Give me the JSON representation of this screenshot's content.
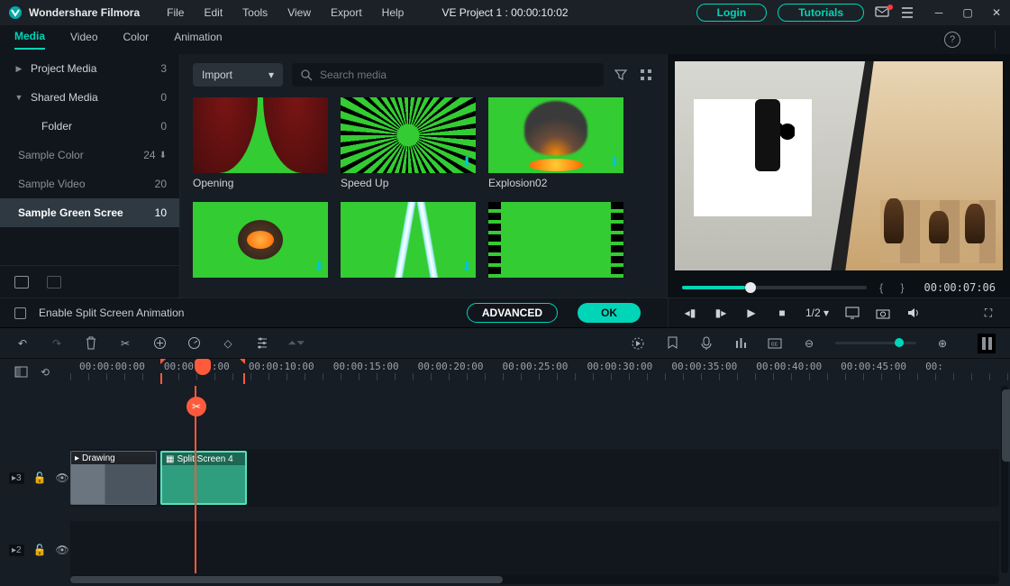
{
  "app": {
    "name": "Wondershare Filmora",
    "project_title": "VE Project 1 : 00:00:10:02"
  },
  "menus": [
    "File",
    "Edit",
    "Tools",
    "View",
    "Export",
    "Help"
  ],
  "title_buttons": {
    "login": "Login",
    "tutorials": "Tutorials"
  },
  "tabs": [
    "Media",
    "Video",
    "Color",
    "Animation"
  ],
  "sidebar": {
    "items": [
      {
        "label": "Project Media",
        "count": "3",
        "arrow": "▶"
      },
      {
        "label": "Shared Media",
        "count": "0",
        "arrow": "▼"
      },
      {
        "label": "Folder",
        "count": "0"
      },
      {
        "label": "Sample Color",
        "count": "24"
      },
      {
        "label": "Sample Video",
        "count": "20"
      },
      {
        "label": "Sample Green Scree",
        "count": "10"
      }
    ]
  },
  "media": {
    "import_label": "Import",
    "search_placeholder": "Search media",
    "thumbs": [
      {
        "label": "Opening"
      },
      {
        "label": "Speed Up"
      },
      {
        "label": "Explosion02"
      },
      {
        "label": ""
      },
      {
        "label": ""
      },
      {
        "label": ""
      }
    ]
  },
  "preview": {
    "timecode": "00:00:07:06",
    "braces": "{  }"
  },
  "controls": {
    "split_screen_label": "Enable Split Screen Animation",
    "advanced": "ADVANCED",
    "ok": "OK",
    "ratio": "1/2"
  },
  "ruler": {
    "labels": [
      "00:00:00:00",
      "00:00:05:00",
      "00:00:10:00",
      "00:00:15:00",
      "00:00:20:00",
      "00:00:25:00",
      "00:00:30:00",
      "00:00:35:00",
      "00:00:40:00",
      "00:00:45:00",
      "00:"
    ]
  },
  "timeline": {
    "track1": {
      "id": "3",
      "clip1": "Drawing",
      "clip2": "Split Screen 4"
    },
    "track2": {
      "id": "2"
    }
  }
}
